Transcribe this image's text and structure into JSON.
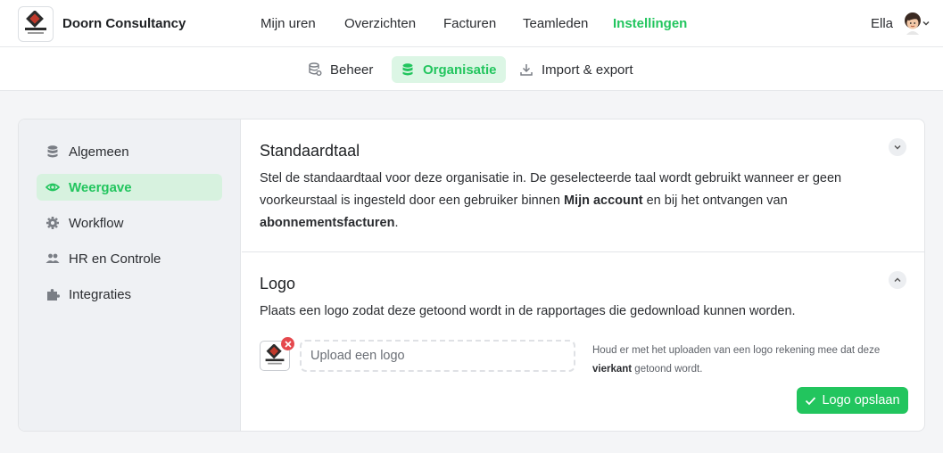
{
  "brand": {
    "name": "Doorn Consultancy",
    "logo_text": "VAN DOORN",
    "logo_subtext": "CONSULTANCY"
  },
  "nav": {
    "items": [
      {
        "label": "Mijn uren"
      },
      {
        "label": "Overzichten"
      },
      {
        "label": "Facturen"
      },
      {
        "label": "Teamleden"
      },
      {
        "label": "Instellingen",
        "active": true
      }
    ]
  },
  "user": {
    "name": "Ella",
    "avatar_icon": "user-avatar"
  },
  "subnav": {
    "items": [
      {
        "label": "Beheer",
        "icon": "database-settings-icon"
      },
      {
        "label": "Organisatie",
        "icon": "database-icon",
        "active": true
      },
      {
        "label": "Import & export",
        "icon": "download-icon"
      }
    ]
  },
  "sidebar": {
    "items": [
      {
        "label": "Algemeen",
        "icon": "database-icon"
      },
      {
        "label": "Weergave",
        "icon": "eye-icon",
        "active": true
      },
      {
        "label": "Workflow",
        "icon": "gear-icon"
      },
      {
        "label": "HR en Controle",
        "icon": "users-icon"
      },
      {
        "label": "Integraties",
        "icon": "puzzle-icon"
      }
    ]
  },
  "language_section": {
    "title": "Standaardtaal",
    "text_1": "Stel de standaardtaal voor deze organisatie in. De geselecteerde taal wordt gebruikt wanneer er geen voorkeurstaal is ingesteld door een gebruiker binnen ",
    "bold_1": "Mijn account",
    "text_2": " en bij het ontvangen van ",
    "bold_2": "abonnementsfacturen",
    "text_3": "."
  },
  "logo_section": {
    "title": "Logo",
    "description": "Plaats een logo zodat deze getoond wordt in de rapportages die gedownload kunnen worden.",
    "upload_label": "Upload een logo",
    "hint_1": "Houd er met het uploaden van een logo rekening mee dat deze ",
    "hint_bold": "vierkant",
    "hint_2": " getoond wordt.",
    "save_label": "Logo opslaan"
  },
  "colors": {
    "accent": "#22c55e",
    "accent_bg": "#dcf6e5",
    "danger": "#e5484d",
    "sidebar_bg": "#eff1f4",
    "page_bg": "#f4f5f7"
  }
}
